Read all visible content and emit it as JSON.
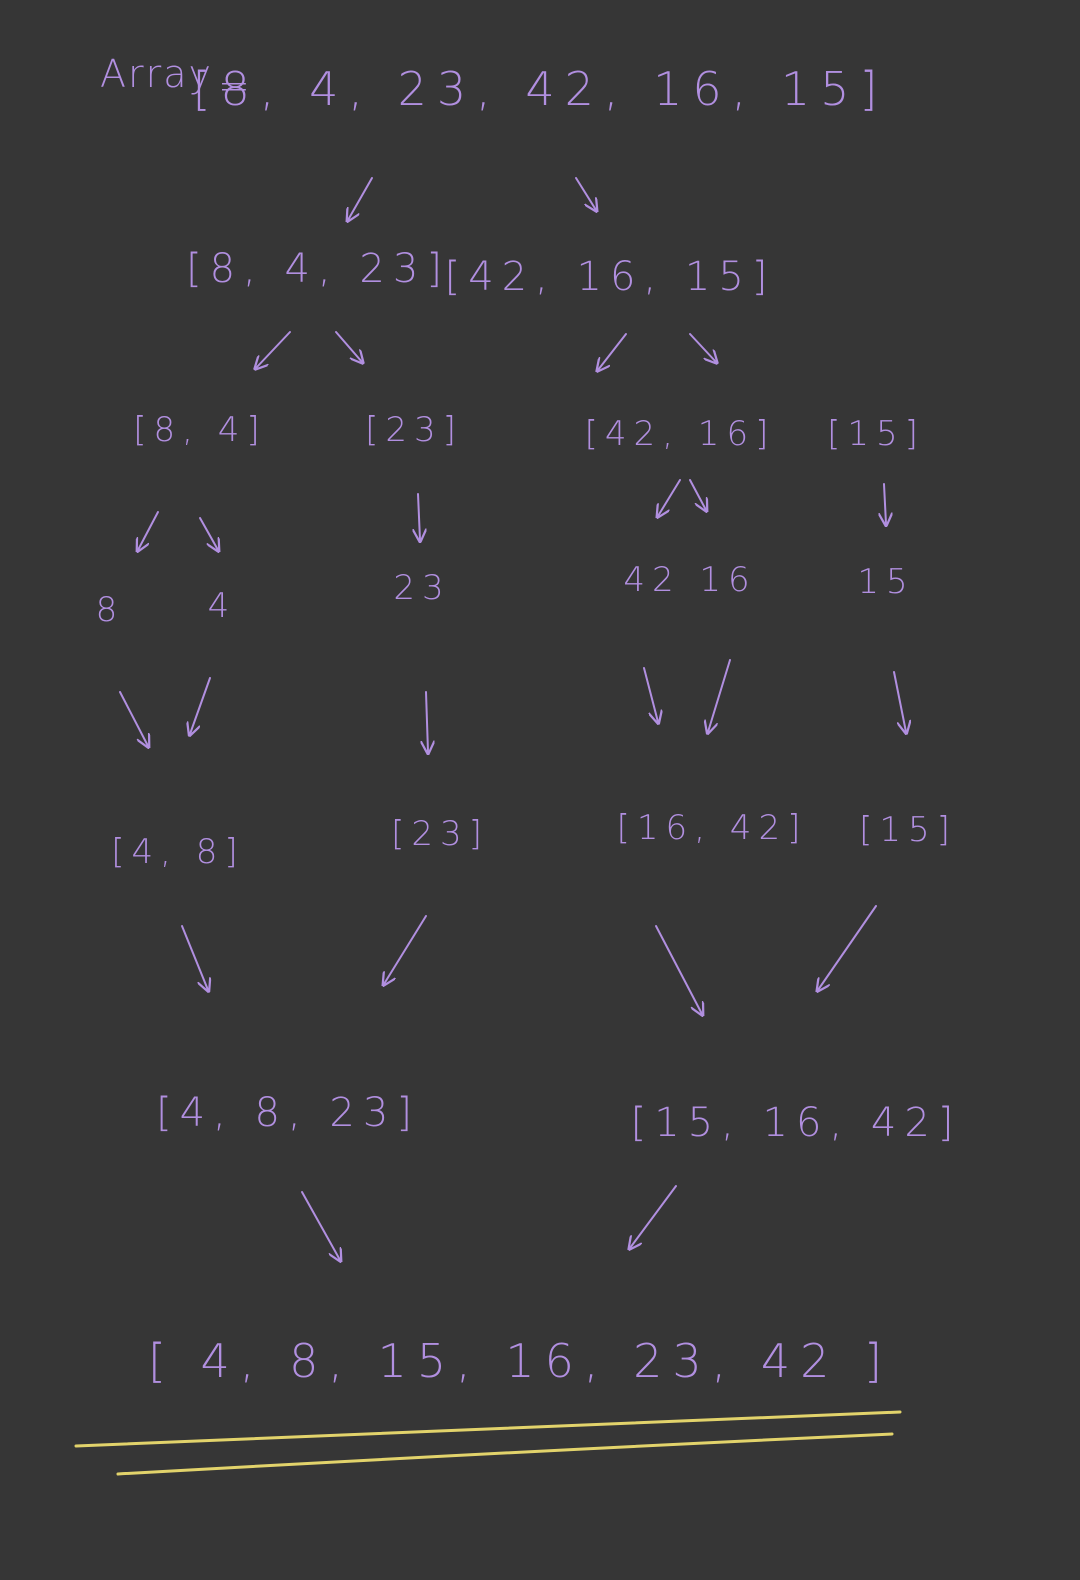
{
  "title": {
    "label": "Array",
    "equals": "="
  },
  "colors": {
    "background": "#363636",
    "ink": "#b18fe0",
    "underline": "#e2d36b"
  },
  "rows": {
    "root": [
      "[8, 4, 23, 42, 16, 15]"
    ],
    "split1": [
      "[8, 4, 23]",
      "[42, 16, 15]"
    ],
    "split2": [
      "[8, 4]",
      "[23]",
      "[42, 16]",
      "[15]"
    ],
    "singles": [
      "8",
      "4",
      "23",
      "42",
      "16",
      "15"
    ],
    "merge1": [
      "[4, 8]",
      "[23]",
      "[16, 42]",
      "[15]"
    ],
    "merge2": [
      "[4, 8, 23]",
      "[15, 16, 42]"
    ],
    "result": [
      "[ 4,  8,  15,  16,  23,  42 ]"
    ]
  }
}
